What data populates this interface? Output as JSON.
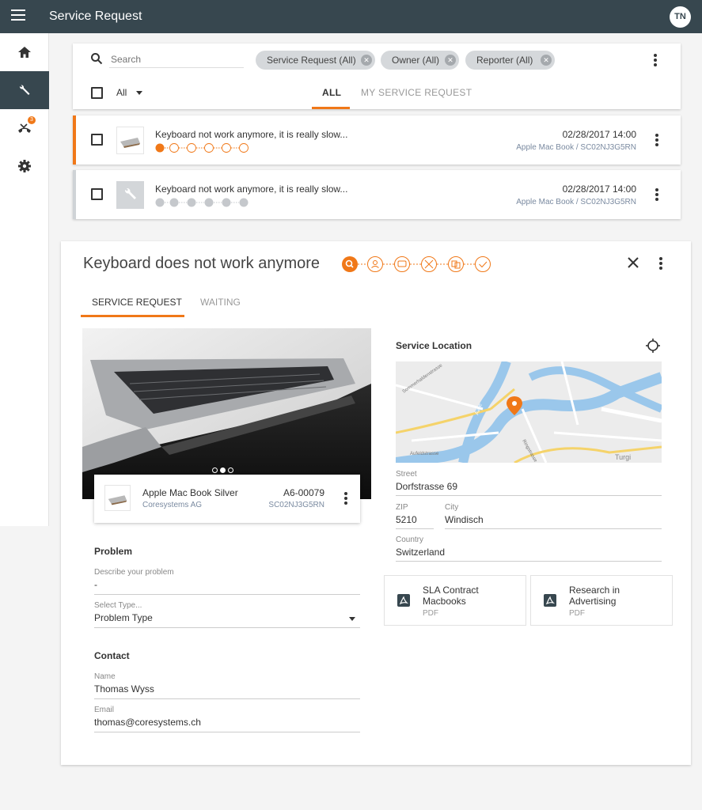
{
  "app": {
    "title": "Service Request",
    "user_initials": "TN"
  },
  "sidebar": {
    "items": [
      {
        "name": "home"
      },
      {
        "name": "service-requests",
        "active": true
      },
      {
        "name": "calls",
        "badge": "3"
      },
      {
        "name": "settings"
      }
    ]
  },
  "filters": {
    "search_placeholder": "Search",
    "chips": [
      "Service Request (All)",
      "Owner (All)",
      "Reporter (All)"
    ],
    "select_all_label": "All",
    "tabs": [
      "ALL",
      "MY SERVICE REQUEST"
    ],
    "active_tab": "ALL"
  },
  "list": [
    {
      "title": "Keyboard not work anymore, it is really slow...",
      "date": "02/28/2017 14:00",
      "device": "Apple Mac Book / SC02NJ3G5RN",
      "active": true
    },
    {
      "title": "Keyboard not work anymore, it is really slow...",
      "date": "02/28/2017 14:00",
      "device": "Apple Mac Book / SC02NJ3G5RN",
      "active": false
    }
  ],
  "detail": {
    "title": "Keyboard does not work anymore",
    "tabs": [
      "SERVICE REQUEST",
      "WAITING"
    ],
    "active_tab": "SERVICE REQUEST",
    "device": {
      "name": "Apple Mac Book Silver",
      "company": "Coresystems AG",
      "code": "A6-00079",
      "serial": "SC02NJ3G5RN"
    },
    "problem": {
      "heading": "Problem",
      "describe_label": "Describe your problem",
      "describe_value": "-",
      "type_label": "Select Type...",
      "type_value": "Problem Type"
    },
    "contact": {
      "heading": "Contact",
      "name_label": "Name",
      "name_value": "Thomas Wyss",
      "email_label": "Email",
      "email_value": "thomas@coresystems.ch"
    },
    "location": {
      "heading": "Service Location",
      "street_label": "Street",
      "street_value": "Dorfstrasse 69",
      "zip_label": "ZIP",
      "zip_value": "5210",
      "city_label": "City",
      "city_value": "Windisch",
      "country_label": "Country",
      "country_value": "Switzerland",
      "map_labels": [
        "Sommerhaldenstrasse",
        "Aufeldstrasse",
        "Ringstrasse",
        "Turgi",
        "Aare"
      ]
    },
    "documents": [
      {
        "title": "SLA Contract Macbooks",
        "type": "PDF"
      },
      {
        "title": "Research in Advertising",
        "type": "PDF"
      }
    ]
  },
  "colors": {
    "accent": "#f07818",
    "topbar": "#37474f",
    "muted_step": "#c5c8cc"
  }
}
